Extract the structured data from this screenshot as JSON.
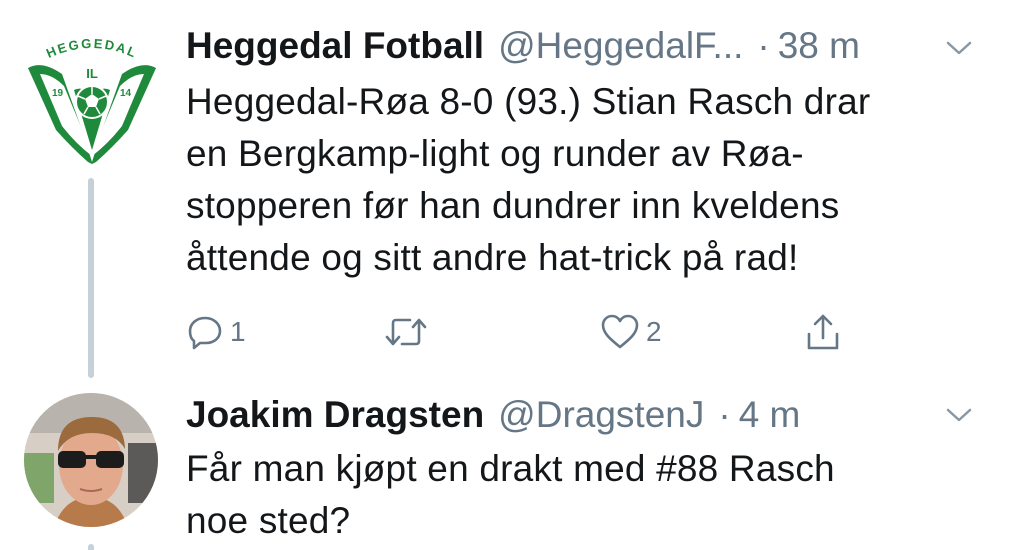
{
  "tweets": [
    {
      "author_name": "Heggedal Fotball",
      "handle": "@HeggedalF...",
      "separator": "·",
      "time": "38 m",
      "body_lines": [
        "Heggedal-Røa 8-0 (93.) Stian Rasch drar",
        "en Bergkamp-light og runder av Røa-",
        "stopperen før han dundrer inn kveldens",
        "åttende og sitt andre hat-trick på rad!"
      ],
      "reply_count": "1",
      "retweet_count": "",
      "like_count": "2",
      "logo": {
        "arc_text": "HEGGEDAL",
        "il_text": "IL",
        "year_left": "19",
        "year_right": "14",
        "color": "#1f8a3b"
      }
    },
    {
      "author_name": "Joakim Dragsten",
      "handle": "@DragstenJ",
      "separator": "·",
      "time": "4 m",
      "body_lines": [
        "Får man kjøpt en drakt med #88 Rasch",
        "noe sted?"
      ]
    }
  ],
  "icons": {
    "reply": "reply-icon",
    "retweet": "retweet-icon",
    "like": "heart-icon",
    "share": "share-icon",
    "more": "chevron-down-icon"
  },
  "colors": {
    "text": "#14171a",
    "secondary": "#657786",
    "icon": "#657786",
    "thread_line": "#c6d0d8",
    "logo_green": "#1f8a3b"
  }
}
